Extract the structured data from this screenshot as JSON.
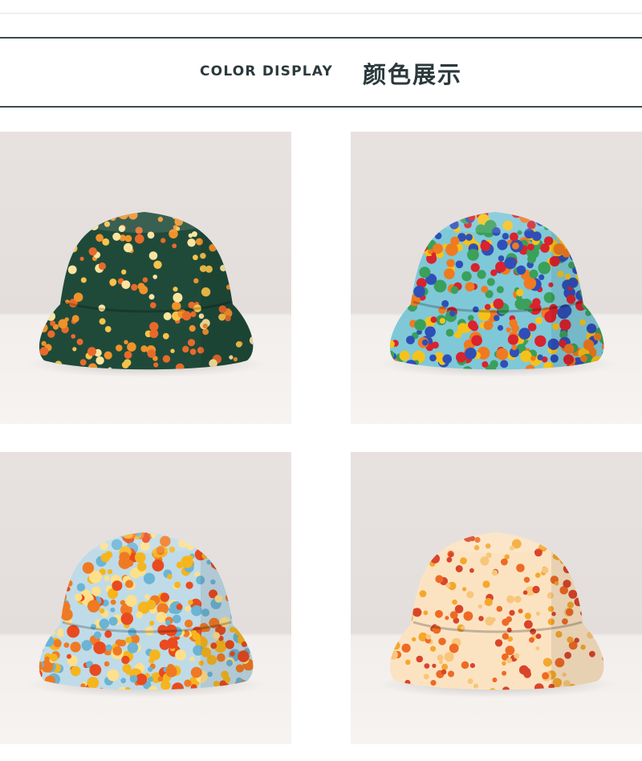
{
  "header": {
    "title_en": "COLOR DISPLAY",
    "title_zh": "颜色展示"
  },
  "products": [
    {
      "name": "dark-green-dot-hat",
      "base": "#1f4a3a",
      "dots": [
        "#f7c34a",
        "#f0922a",
        "#fbe4a0",
        "#e86a2a"
      ]
    },
    {
      "name": "blue-red-floral-hat",
      "base": "#7fc8d8",
      "dots": [
        "#d9232e",
        "#2f4fb8",
        "#f5c21b",
        "#3aa05a",
        "#f07a1f"
      ]
    },
    {
      "name": "light-blue-orange-floral-hat",
      "base": "#bfdbe8",
      "dots": [
        "#e94a1f",
        "#f5b51e",
        "#f07a23",
        "#6bb4d4",
        "#ffe08a"
      ]
    },
    {
      "name": "cream-orange-dot-hat",
      "base": "#fbe3c2",
      "dots": [
        "#ee6a24",
        "#f5a72c",
        "#d9452a",
        "#f8c67a"
      ]
    }
  ],
  "colors": {
    "text": "#2c393c",
    "rule": "#3b4a4d",
    "photo_bg_top": "#e7e2e0",
    "photo_bg_bottom": "#f1eeec"
  }
}
